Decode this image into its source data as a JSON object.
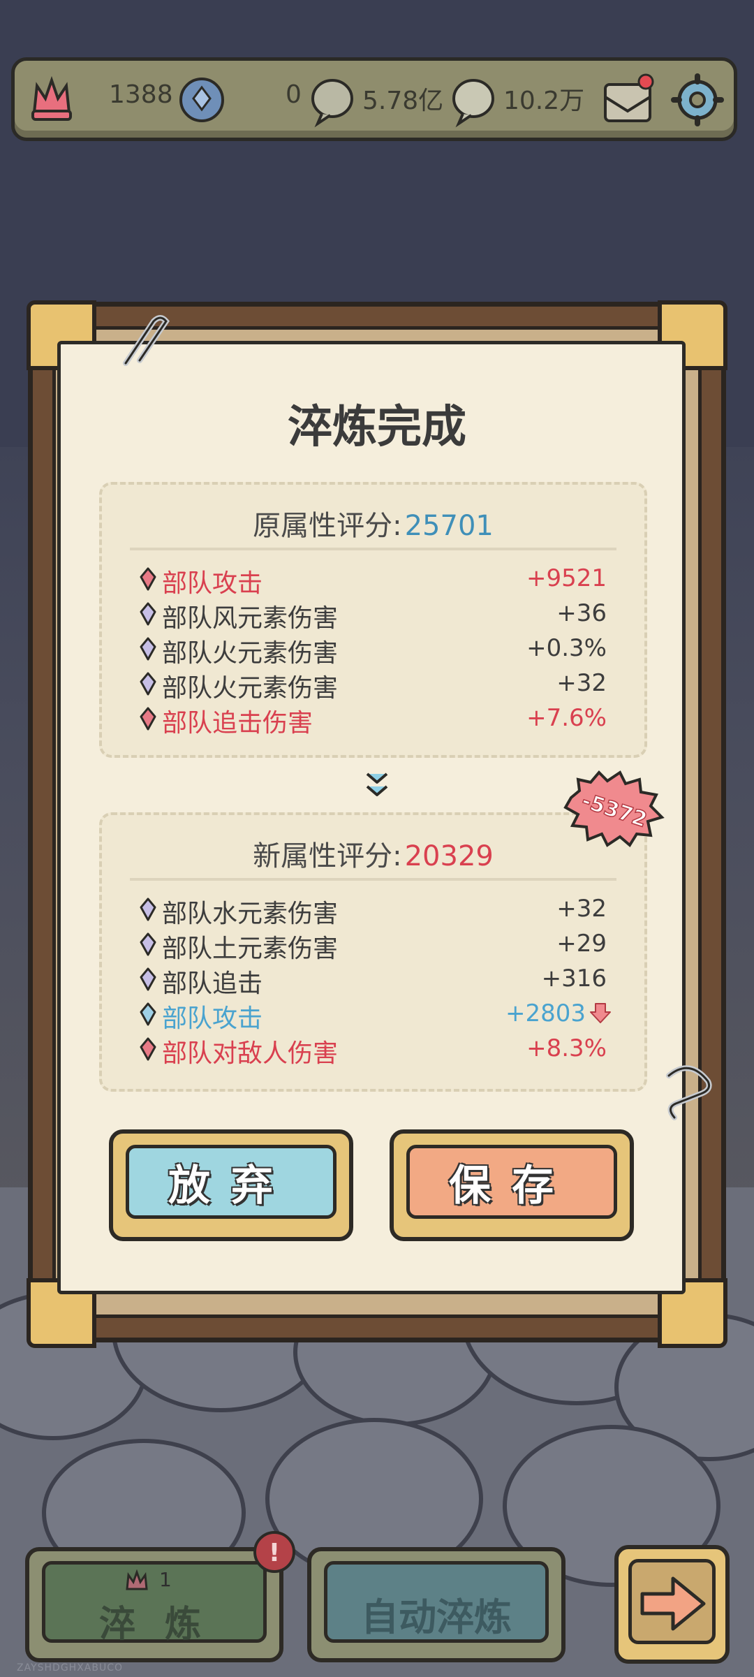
{
  "resources": {
    "gem_count": "1388",
    "blue_count": "0",
    "coin_a": "5.78亿",
    "coin_b": "10.2万"
  },
  "popup": {
    "title": "淬炼完成",
    "original": {
      "header_label": "原属性评分:",
      "score": "25701",
      "rows": [
        {
          "label": "部队攻击",
          "value": "+9521",
          "tier": "red"
        },
        {
          "label": "部队风元素伤害",
          "value": "+36",
          "tier": "purple"
        },
        {
          "label": "部队火元素伤害",
          "value": "+0.3%",
          "tier": "purple"
        },
        {
          "label": "部队火元素伤害",
          "value": "+32",
          "tier": "purple"
        },
        {
          "label": "部队追击伤害",
          "value": "+7.6%",
          "tier": "red"
        }
      ]
    },
    "new": {
      "header_label": "新属性评分:",
      "score": "20329",
      "diff_badge": "-5372",
      "rows": [
        {
          "label": "部队水元素伤害",
          "value": "+32",
          "tier": "purple"
        },
        {
          "label": "部队土元素伤害",
          "value": "+29",
          "tier": "purple"
        },
        {
          "label": "部队追击",
          "value": "+316",
          "tier": "purple"
        },
        {
          "label": "部队攻击",
          "value": "+2803",
          "tier": "blue"
        },
        {
          "label": "部队对敌人伤害",
          "value": "+8.3%",
          "tier": "red"
        }
      ]
    },
    "abandon_label": "放弃",
    "save_label": "保存"
  },
  "bottom": {
    "refine_count": "1",
    "refine_label": "淬 炼",
    "auto_label": "自动淬炼",
    "watermark": "ZAYSHDGHXABUCO"
  },
  "colors": {
    "red": "#d9404f",
    "purple": "#3d3d3d",
    "blue": "#4aa3cf",
    "score_blue": "#3f8fb8",
    "score_red": "#d9404f"
  }
}
